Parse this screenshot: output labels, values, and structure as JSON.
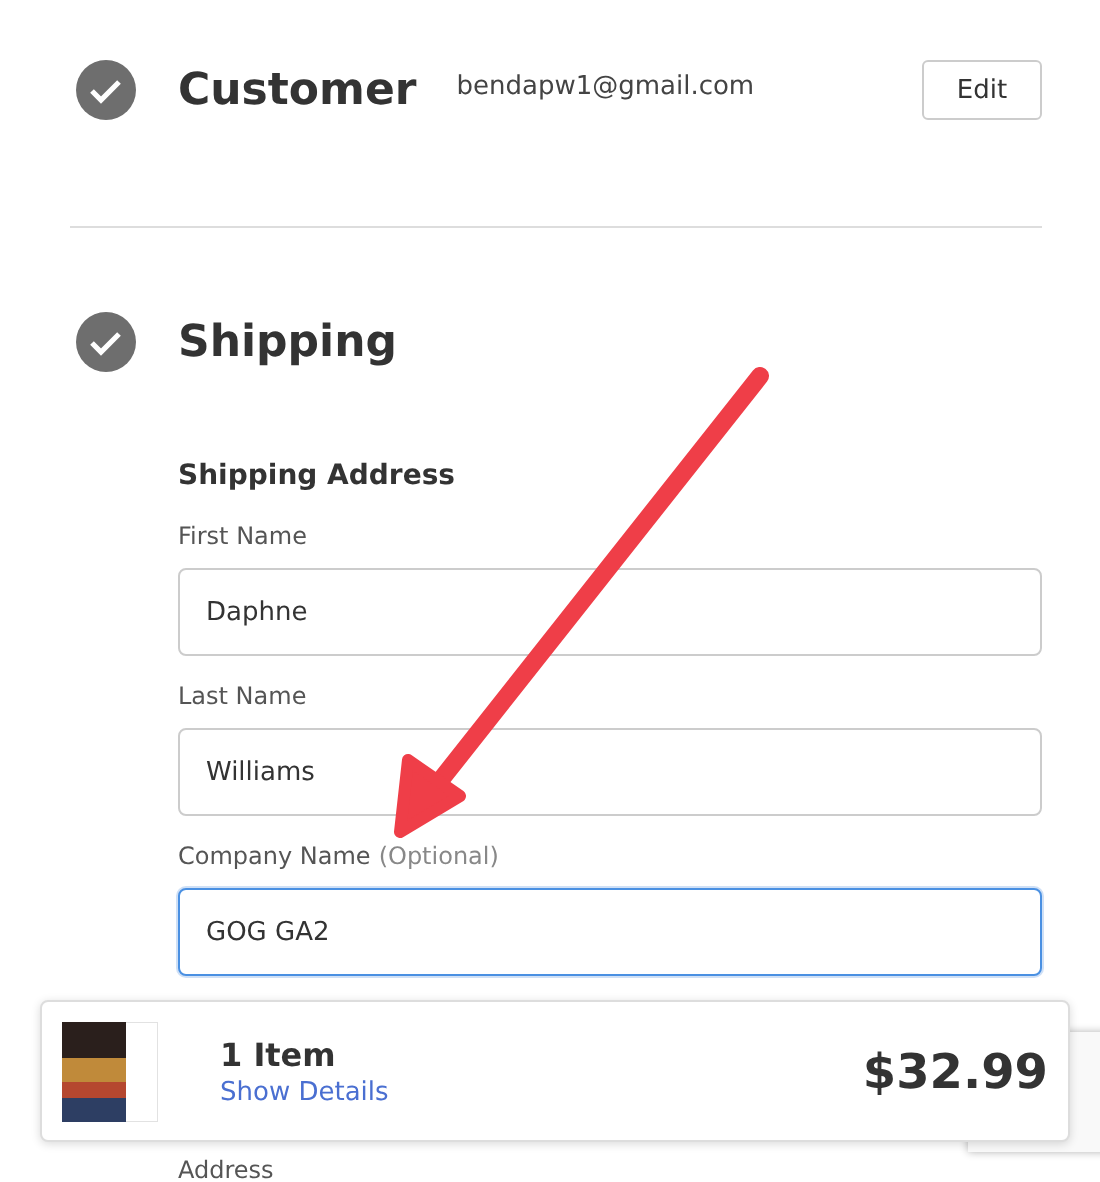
{
  "customer": {
    "title": "Customer",
    "email": "bendapw1@gmail.com",
    "completed": true,
    "edit_button": "Edit"
  },
  "shipping": {
    "title": "Shipping",
    "completed": true,
    "subtitle": "Shipping Address",
    "fields": [
      {
        "label": "First Name",
        "value": "Daphne",
        "focused": false
      },
      {
        "label": "Last Name",
        "value": "Williams",
        "focused": false
      },
      {
        "label": "Company Name",
        "hint": "(Optional)",
        "value": "GOG GA2",
        "focused": true
      },
      {
        "label": "Address"
      }
    ]
  },
  "summary": {
    "count": "1 Item",
    "details_link": "Show Details",
    "total": "$32.99"
  }
}
